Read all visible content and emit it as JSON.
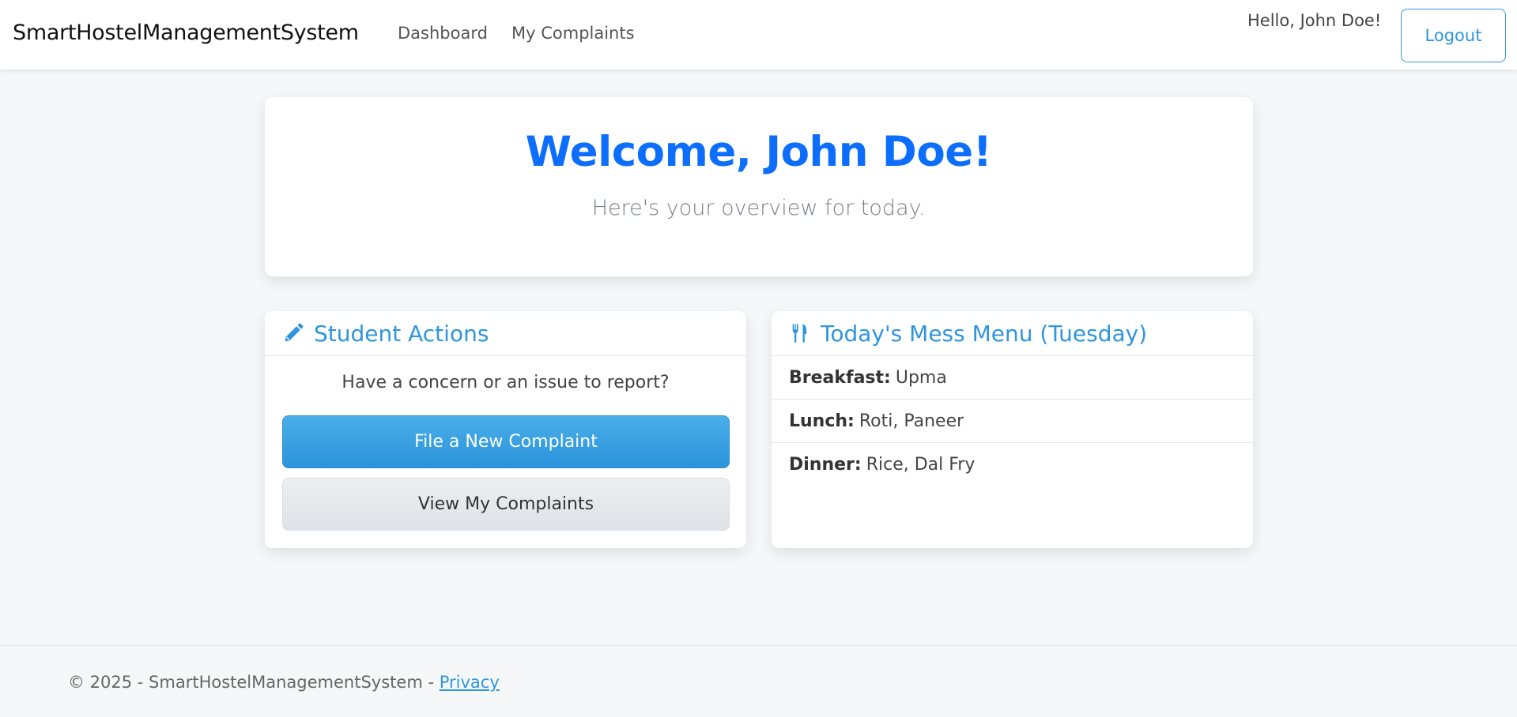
{
  "navbar": {
    "brand": "SmartHostelManagementSystem",
    "links": [
      {
        "label": "Dashboard"
      },
      {
        "label": "My Complaints"
      }
    ],
    "greeting": "Hello, John Doe!",
    "logout_label": "Logout"
  },
  "welcome": {
    "title": "Welcome, John Doe!",
    "subtitle": "Here's your overview for today."
  },
  "actions": {
    "header": "Student Actions",
    "icon": "pencil-icon",
    "prompt": "Have a concern or an issue to report?",
    "primary_label": "File a New Complaint",
    "secondary_label": "View My Complaints"
  },
  "menu": {
    "header": "Today's Mess Menu (Tuesday)",
    "icon": "utensils-icon",
    "items": [
      {
        "meal": "Breakfast:",
        "dish": "Upma"
      },
      {
        "meal": "Lunch:",
        "dish": "Roti, Paneer"
      },
      {
        "meal": "Dinner:",
        "dish": "Rice, Dal Fry"
      }
    ]
  },
  "footer": {
    "text": "© 2025 - SmartHostelManagementSystem -",
    "link": "Privacy"
  },
  "colors": {
    "accent": "#2f96dd",
    "title_blue": "#0d6efd",
    "background": "#f6f7f9"
  }
}
